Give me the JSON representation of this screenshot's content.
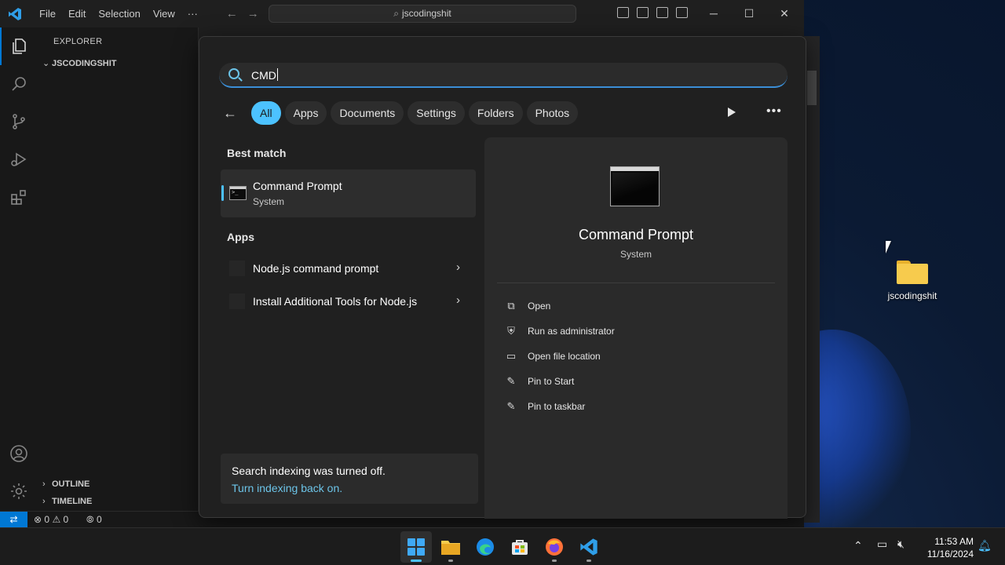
{
  "desktop": {
    "folder_label": "jscodingshit"
  },
  "vscode": {
    "menu": [
      "File",
      "Edit",
      "Selection",
      "View",
      "···"
    ],
    "command_center": "jscodingshit",
    "sidebar": {
      "title": "EXPLORER",
      "folder": "JSCODINGSHIT",
      "outline": "OUTLINE",
      "timeline": "TIMELINE"
    },
    "status": {
      "errors": "0",
      "warnings": "0",
      "ports": "0"
    }
  },
  "search": {
    "query": "CMD",
    "filters": [
      "All",
      "Apps",
      "Documents",
      "Settings",
      "Folders",
      "Photos"
    ],
    "active_filter": "All",
    "best_match_heading": "Best match",
    "best_match": {
      "name": "Command Prompt",
      "type": "System"
    },
    "apps_heading": "Apps",
    "apps": [
      {
        "name": "Node.js command prompt"
      },
      {
        "name": "Install Additional Tools for Node.js"
      }
    ],
    "detail": {
      "name": "Command Prompt",
      "type": "System",
      "actions": [
        {
          "label": "Open",
          "icon": "open-external-icon"
        },
        {
          "label": "Run as administrator",
          "icon": "shield-admin-icon"
        },
        {
          "label": "Open file location",
          "icon": "folder-icon"
        },
        {
          "label": "Pin to Start",
          "icon": "pin-icon"
        },
        {
          "label": "Pin to taskbar",
          "icon": "pin-icon"
        }
      ]
    },
    "index_notice": {
      "text": "Search indexing was turned off.",
      "link": "Turn indexing back on."
    }
  },
  "taskbar": {
    "time": "11:53 AM",
    "date": "11/16/2024"
  },
  "colors": {
    "accent": "#4cc2ff",
    "vscode_blue": "#0078d4"
  }
}
